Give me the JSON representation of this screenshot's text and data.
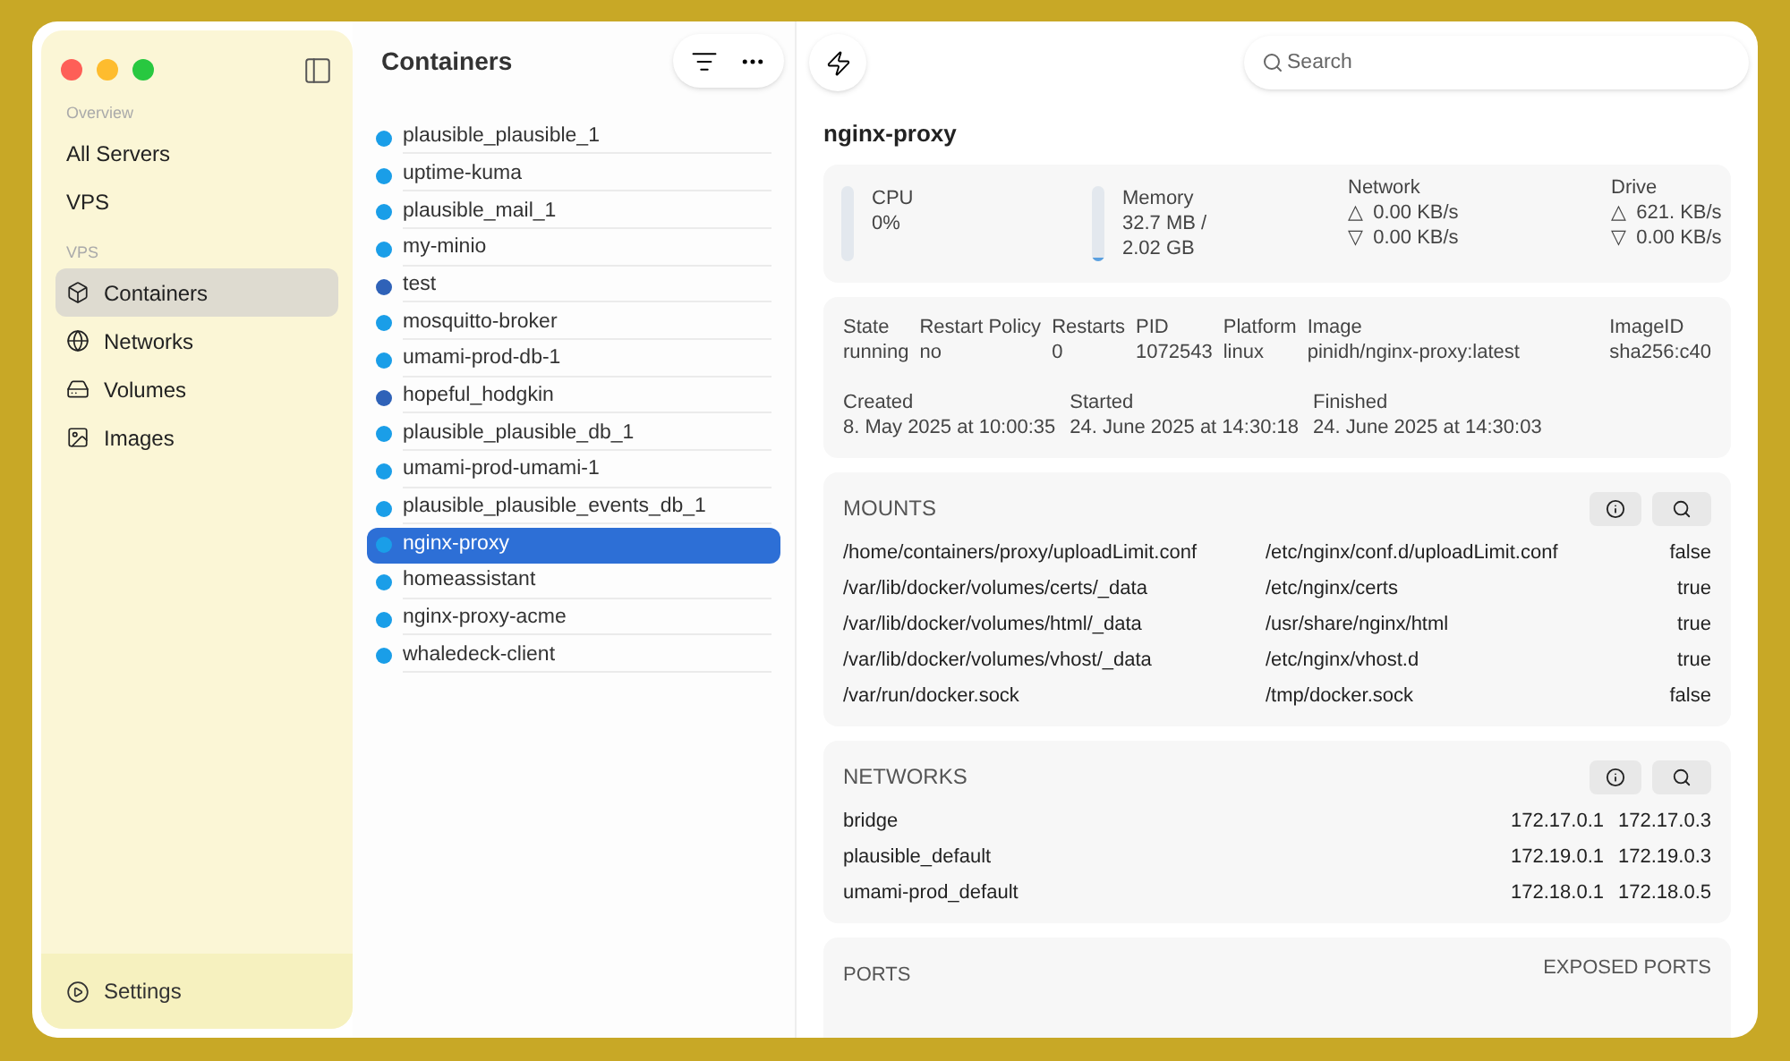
{
  "sidebar": {
    "sections": [
      {
        "title": "Overview",
        "items": [
          {
            "label": "All Servers",
            "selected": false
          },
          {
            "label": "VPS",
            "selected": false
          }
        ]
      },
      {
        "title": "VPS",
        "items": [
          {
            "label": "Containers",
            "selected": true
          },
          {
            "label": "Networks",
            "selected": false
          },
          {
            "label": "Volumes",
            "selected": false
          },
          {
            "label": "Images",
            "selected": false
          }
        ]
      }
    ],
    "settings": "Settings"
  },
  "list": {
    "title": "Containers",
    "items": [
      {
        "name": "plausible_plausible_1",
        "color": "#1a9ee8",
        "selected": false
      },
      {
        "name": "uptime-kuma",
        "color": "#1a9ee8",
        "selected": false
      },
      {
        "name": "plausible_mail_1",
        "color": "#1a9ee8",
        "selected": false
      },
      {
        "name": "my-minio",
        "color": "#1a9ee8",
        "selected": false
      },
      {
        "name": "test",
        "color": "#2f62b8",
        "selected": false
      },
      {
        "name": "mosquitto-broker",
        "color": "#1a9ee8",
        "selected": false
      },
      {
        "name": "umami-prod-db-1",
        "color": "#1a9ee8",
        "selected": false
      },
      {
        "name": "hopeful_hodgkin",
        "color": "#2f62b8",
        "selected": false
      },
      {
        "name": "plausible_plausible_db_1",
        "color": "#1a9ee8",
        "selected": false
      },
      {
        "name": "umami-prod-umami-1",
        "color": "#1a9ee8",
        "selected": false
      },
      {
        "name": "plausible_plausible_events_db_1",
        "color": "#1a9ee8",
        "selected": false
      },
      {
        "name": "nginx-proxy",
        "color": "#1a9ee8",
        "selected": true
      },
      {
        "name": "homeassistant",
        "color": "#1a9ee8",
        "selected": false
      },
      {
        "name": "nginx-proxy-acme",
        "color": "#1a9ee8",
        "selected": false
      },
      {
        "name": "whaledeck-client",
        "color": "#1a9ee8",
        "selected": false
      }
    ]
  },
  "search": {
    "placeholder": "Search"
  },
  "detail": {
    "title": "nginx-proxy",
    "stats": [
      {
        "kind": "meter",
        "label": "CPU",
        "lines": [
          "0%"
        ]
      },
      {
        "kind": "meter",
        "label": "Memory",
        "lines": [
          "32.7 MB /",
          "2.02 GB"
        ],
        "level": 0.03
      },
      {
        "kind": "io",
        "label": "Network",
        "up": "0.00 KB/s",
        "down": "0.00 KB/s",
        "up_glyph": "△",
        "down_glyph": "▽"
      },
      {
        "kind": "io",
        "label": "Drive",
        "up": "621. KB/s",
        "down": "0.00 KB/s",
        "up_glyph": "△",
        "down_glyph": "▽"
      }
    ],
    "info": [
      {
        "label": "State",
        "value": "running"
      },
      {
        "label": "Restart Policy",
        "value": "no"
      },
      {
        "label": "Restarts",
        "value": "0"
      },
      {
        "label": "PID",
        "value": "1072543"
      },
      {
        "label": "Platform",
        "value": "linux"
      },
      {
        "label": "Image",
        "value": "pinidh/nginx-proxy:latest"
      },
      {
        "label": "ImageID",
        "value": "sha256:c40"
      }
    ],
    "times": [
      {
        "label": "Created",
        "value": "8. May 2025 at 10:00:35"
      },
      {
        "label": "Started",
        "value": "24. June 2025 at 14:30:18"
      },
      {
        "label": "Finished",
        "value": "24. June 2025 at 14:30:03"
      }
    ],
    "mounts": {
      "title": "MOUNTS",
      "rows": [
        [
          "/home/containers/proxy/uploadLimit.conf",
          "/etc/nginx/conf.d/uploadLimit.conf",
          "false"
        ],
        [
          "/var/lib/docker/volumes/certs/_data",
          "/etc/nginx/certs",
          "true"
        ],
        [
          "/var/lib/docker/volumes/html/_data",
          "/usr/share/nginx/html",
          "true"
        ],
        [
          "/var/lib/docker/volumes/vhost/_data",
          "/etc/nginx/vhost.d",
          "true"
        ],
        [
          "/var/run/docker.sock",
          "/tmp/docker.sock",
          "false"
        ]
      ]
    },
    "networks": {
      "title": "NETWORKS",
      "rows": [
        [
          "bridge",
          "172.17.0.1",
          "172.17.0.3"
        ],
        [
          "plausible_default",
          "172.19.0.1",
          "172.19.0.3"
        ],
        [
          "umami-prod_default",
          "172.18.0.1",
          "172.18.0.5"
        ]
      ]
    },
    "ports": {
      "title": "PORTS",
      "exposed_title": "EXPOSED PORTS"
    }
  }
}
